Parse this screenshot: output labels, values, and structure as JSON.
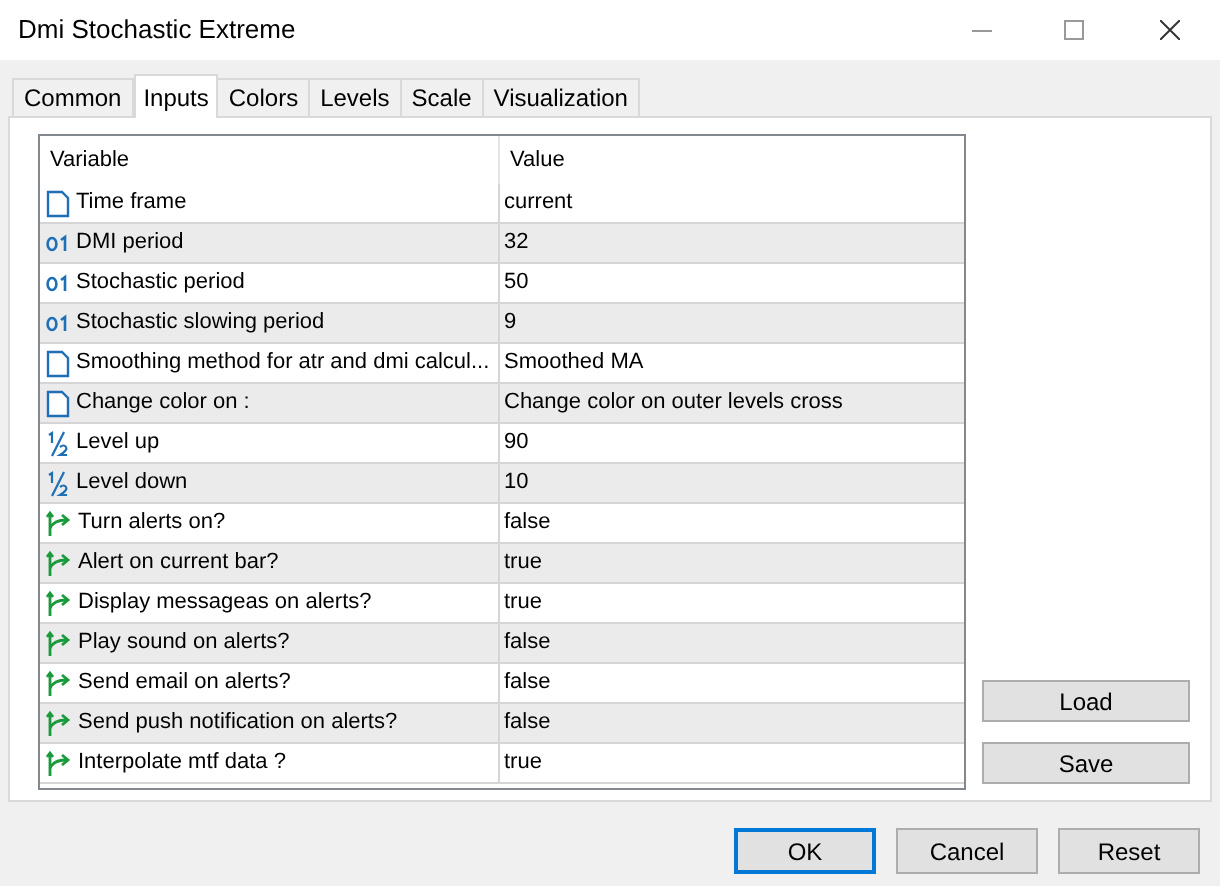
{
  "window": {
    "title": "Dmi Stochastic Extreme"
  },
  "tabs": [
    {
      "label": "Common",
      "selected": false
    },
    {
      "label": "Inputs",
      "selected": true
    },
    {
      "label": "Colors",
      "selected": false
    },
    {
      "label": "Levels",
      "selected": false
    },
    {
      "label": "Scale",
      "selected": false
    },
    {
      "label": "Visualization",
      "selected": false
    }
  ],
  "table": {
    "columns": [
      "Variable",
      "Value"
    ],
    "rows": [
      {
        "kind": "text",
        "variable": "Time frame",
        "value": "current"
      },
      {
        "kind": "int",
        "variable": "DMI period",
        "value": "32"
      },
      {
        "kind": "int",
        "variable": "Stochastic period",
        "value": "50"
      },
      {
        "kind": "int",
        "variable": "Stochastic slowing period",
        "value": "9"
      },
      {
        "kind": "text",
        "variable": "Smoothing method for atr and dmi calcul...",
        "value": "Smoothed MA"
      },
      {
        "kind": "text",
        "variable": "Change color on :",
        "value": "Change color on outer levels cross"
      },
      {
        "kind": "double",
        "variable": "Level up",
        "value": "90"
      },
      {
        "kind": "double",
        "variable": "Level down",
        "value": "10"
      },
      {
        "kind": "bool",
        "variable": "Turn alerts on?",
        "value": "false"
      },
      {
        "kind": "bool",
        "variable": "Alert on current bar?",
        "value": "true"
      },
      {
        "kind": "bool",
        "variable": "Display messageas on alerts?",
        "value": "true"
      },
      {
        "kind": "bool",
        "variable": "Play sound on alerts?",
        "value": "false"
      },
      {
        "kind": "bool",
        "variable": "Send email on alerts?",
        "value": "false"
      },
      {
        "kind": "bool",
        "variable": "Send push notification on alerts?",
        "value": "false"
      },
      {
        "kind": "bool",
        "variable": "Interpolate mtf data ?",
        "value": "true"
      }
    ]
  },
  "side_buttons": [
    "Load",
    "Save"
  ],
  "buttons": [
    "OK",
    "Cancel",
    "Reset"
  ]
}
